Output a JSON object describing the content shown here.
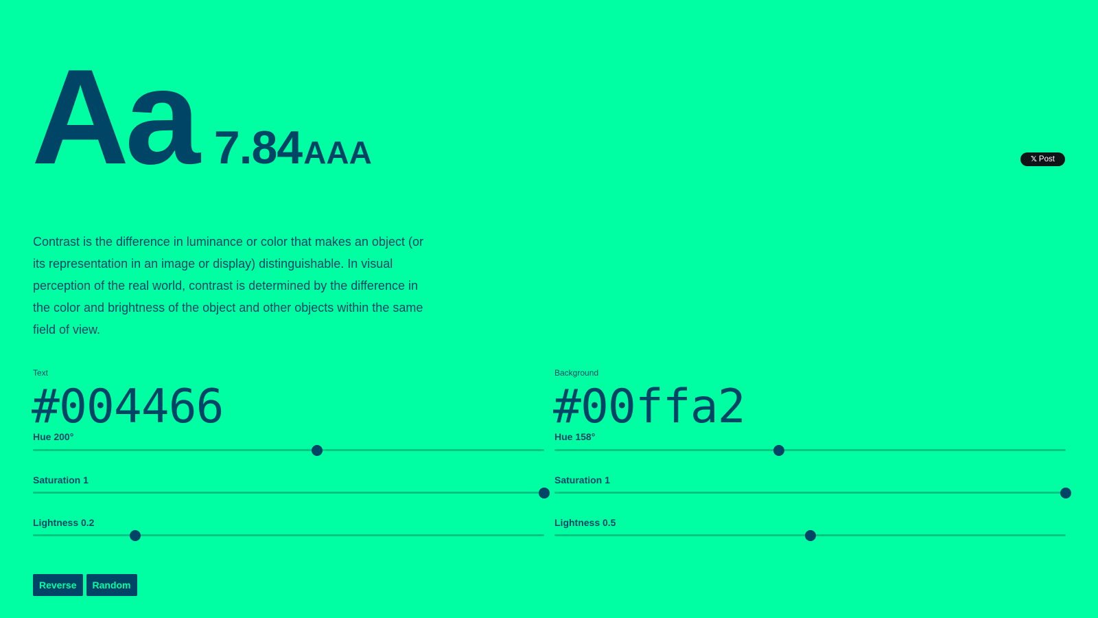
{
  "hero": {
    "sample_text": "Aa",
    "contrast_ratio": "7.84",
    "wcag_level": "AAA"
  },
  "share": {
    "label": "Post",
    "icon": "x-logo-icon"
  },
  "description": "Contrast is the difference in luminance or color that makes an object (or its representation in an image or display) distinguishable. In visual perception of the real world, contrast is determined by the difference in the color and brightness of the object and other objects within the same field of view.",
  "text_color": {
    "label": "Text",
    "hex": "#004466",
    "hue_label": "Hue 200°",
    "hue": 200,
    "saturation_label": "Saturation 1",
    "saturation": 1,
    "lightness_label": "Lightness 0.2",
    "lightness": 0.2
  },
  "background_color": {
    "label": "Background",
    "hex": "#00ffa2",
    "hue_label": "Hue 158°",
    "hue": 158,
    "saturation_label": "Saturation 1",
    "saturation": 1,
    "lightness_label": "Lightness 0.5",
    "lightness": 0.5
  },
  "buttons": {
    "reverse": "Reverse",
    "random": "Random"
  },
  "colors": {
    "text": "#004466",
    "background": "#00ffa2",
    "track": "#00c883"
  }
}
